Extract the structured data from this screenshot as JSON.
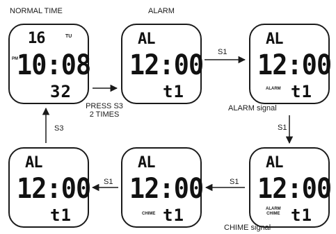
{
  "headings": {
    "normal_time": "NORMAL TIME",
    "alarm": "ALARM"
  },
  "watches": [
    {
      "top": "16",
      "day": "TU",
      "pm": "PM",
      "main": "10:08",
      "bottom": "32",
      "indicator": ""
    },
    {
      "top": "AL",
      "main": "12:00",
      "bottom": "t1",
      "indicator": ""
    },
    {
      "top": "AL",
      "main": "12:00",
      "bottom": "t1",
      "indicator": "ALARM"
    },
    {
      "top": "AL",
      "main": "12:00",
      "bottom": "t1",
      "indicator": "ALARM\nCHIME"
    },
    {
      "top": "AL",
      "main": "12:00",
      "bottom": "t1",
      "indicator": "CHIME"
    },
    {
      "top": "AL",
      "main": "12:00",
      "bottom": "t1",
      "indicator": ""
    }
  ],
  "labels": {
    "press_s3_line1": "PRESS S3",
    "press_s3_line2": "2 TIMES",
    "s1_top": "S1",
    "alarm_signal": "ALARM signal",
    "s1_right": "S1",
    "s1_bottom_right": "S1",
    "chime_signal": "CHIME signal",
    "s1_bottom_left": "S1",
    "s3_left": "S3"
  },
  "colors": {
    "line": "#1a1a1a"
  }
}
